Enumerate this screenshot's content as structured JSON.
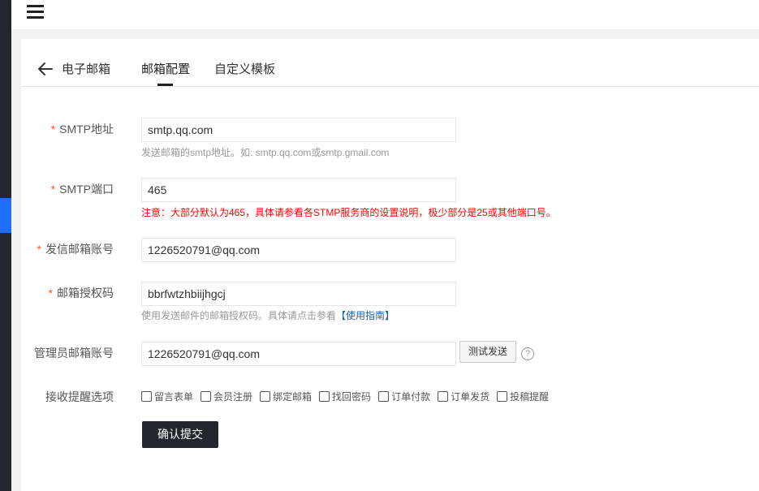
{
  "header": {
    "menu_icon": "hamburger-menu-icon"
  },
  "tabs": {
    "back_icon": "arrow-left-icon",
    "title": "电子邮箱",
    "items": [
      {
        "label": "邮箱配置",
        "active": true
      },
      {
        "label": "自定义模板",
        "active": false
      }
    ]
  },
  "form": {
    "required_mark": "*",
    "smtp_host": {
      "label": "SMTP地址",
      "value": "smtp.qq.com",
      "tip": "发送邮箱的smtp地址。如: smtp.qq.com或smtp.gmail.com"
    },
    "smtp_port": {
      "label": "SMTP端口",
      "value": "465",
      "tip": "注意：大部分默认为465，具体请参看各STMP服务商的设置说明，极少部分是25或其他端口号。"
    },
    "sender_account": {
      "label": "发信邮箱账号",
      "value": "1226520791@qq.com"
    },
    "auth_code": {
      "label": "邮箱授权码",
      "value": "bbrfwtzhbiijhgcj",
      "tip": "使用发送邮件的邮箱授权码。具体请点击参看",
      "tip_link": "【使用指南】"
    },
    "admin_account": {
      "label": "管理员邮箱账号",
      "value": "1226520791@qq.com",
      "test_button": "测试发送",
      "help_icon": "question-circle-icon",
      "help_glyph": "?"
    },
    "notify_options": {
      "label": "接收提醒选项",
      "items": [
        {
          "label": "留言表单",
          "checked": false
        },
        {
          "label": "会员注册",
          "checked": false
        },
        {
          "label": "绑定邮箱",
          "checked": false
        },
        {
          "label": "找回密码",
          "checked": false
        },
        {
          "label": "订单付款",
          "checked": false
        },
        {
          "label": "订单发货",
          "checked": false
        },
        {
          "label": "投稿提醒",
          "checked": false
        }
      ]
    },
    "submit_label": "确认提交"
  },
  "colors": {
    "sidebar": "#23262e",
    "sidebar_active": "#1e6fff",
    "required": "#ff5722",
    "warning": "#ff0000",
    "link": "#1e5fa8",
    "submit_bg": "#23262e"
  }
}
